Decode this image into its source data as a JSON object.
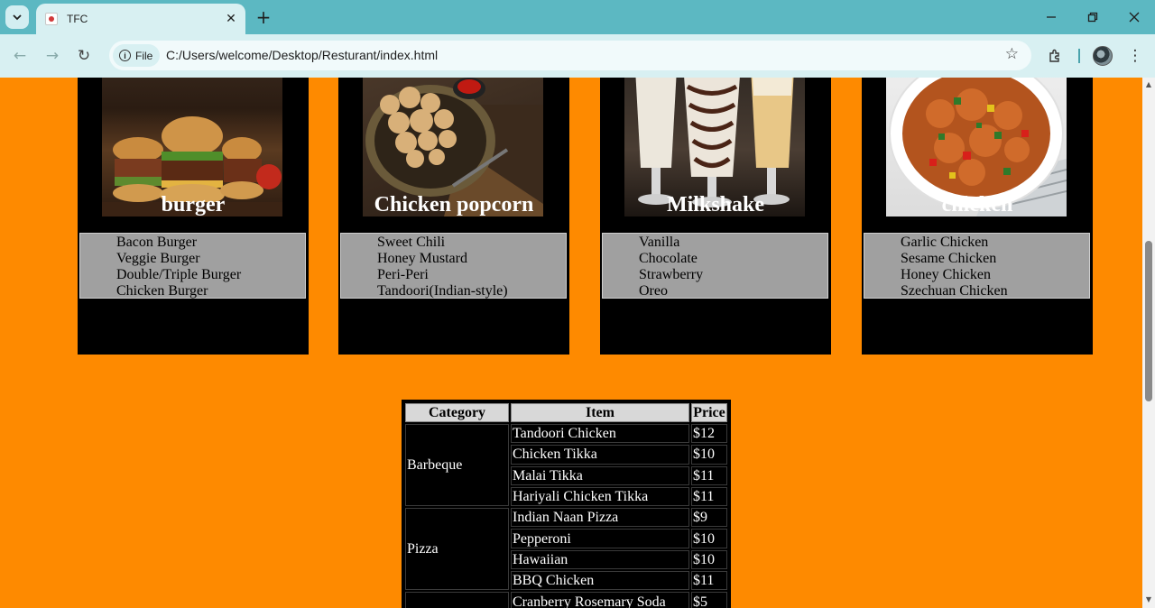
{
  "browser": {
    "tab_title": "TFC",
    "chip_label": "File",
    "url": "C:/Users/welcome/Desktop/Resturant/index.html",
    "icons": [
      "tab-search-icon",
      "close-icon",
      "plus-icon",
      "minimize-icon",
      "restore-icon",
      "window-close-icon",
      "back-icon",
      "forward-icon",
      "reload-icon",
      "info-icon",
      "star-icon",
      "extensions-icon",
      "profile-avatar",
      "more-icon"
    ]
  },
  "cards": [
    {
      "title": "burger",
      "items": [
        "Bacon Burger",
        "Veggie Burger",
        "Double/Triple Burger",
        "Chicken Burger"
      ]
    },
    {
      "title": "Chicken popcorn",
      "items": [
        "Sweet Chili",
        "Honey Mustard",
        "Peri-Peri",
        "Tandoori(Indian-style)"
      ]
    },
    {
      "title": "Milkshake",
      "items": [
        "Vanilla",
        "Chocolate",
        "Strawberry",
        "Oreo"
      ]
    },
    {
      "title": "chicken",
      "items": [
        "Garlic Chicken",
        "Sesame Chicken",
        "Honey Chicken",
        "Szechuan Chicken"
      ]
    }
  ],
  "menu": {
    "headers": [
      "Category",
      "Item",
      "Price"
    ],
    "groups": [
      {
        "category": "Barbeque",
        "rows": [
          {
            "item": "Tandoori Chicken",
            "price": "$12"
          },
          {
            "item": "Chicken Tikka",
            "price": "$10"
          },
          {
            "item": "Malai Tikka",
            "price": "$11"
          },
          {
            "item": "Hariyali Chicken Tikka",
            "price": "$11"
          }
        ]
      },
      {
        "category": "Pizza",
        "rows": [
          {
            "item": "Indian Naan Pizza",
            "price": "$9"
          },
          {
            "item": "Pepperoni",
            "price": "$10"
          },
          {
            "item": "Hawaiian",
            "price": "$10"
          },
          {
            "item": "BBQ Chicken",
            "price": "$11"
          }
        ]
      },
      {
        "category": "",
        "rows": [
          {
            "item": "Cranberry Rosemary Soda",
            "price": "$5"
          }
        ]
      }
    ]
  },
  "colors": {
    "page_bg": "#fe8a00",
    "card_bg": "#000000",
    "list_bg": "#a0a0a0",
    "chrome_tab": "#5cb8c2"
  }
}
